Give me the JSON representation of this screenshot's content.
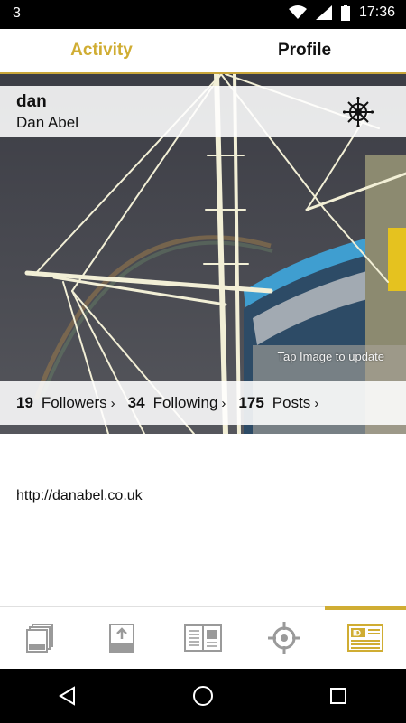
{
  "status": {
    "notification_count": "3",
    "time": "17:36"
  },
  "tabs": [
    {
      "label": "Activity"
    },
    {
      "label": "Profile"
    }
  ],
  "profile": {
    "username": "dan",
    "full_name": "Dan Abel",
    "tap_hint": "Tap Image to update",
    "stats": [
      {
        "value": "19",
        "label": "Followers",
        "chevron": "›"
      },
      {
        "value": "34",
        "label": "Following",
        "chevron": "›"
      },
      {
        "value": "175",
        "label": "Posts",
        "chevron": "›"
      }
    ],
    "website": "http://danabel.co.uk"
  },
  "bottom_nav": [
    {
      "icon": "photos-stack-icon"
    },
    {
      "icon": "upload-icon"
    },
    {
      "icon": "magazine-icon"
    },
    {
      "icon": "location-target-icon"
    },
    {
      "icon": "id-card-icon"
    }
  ],
  "colors": {
    "accent": "#d0ad33",
    "icon_grey": "#9a9a9a"
  }
}
